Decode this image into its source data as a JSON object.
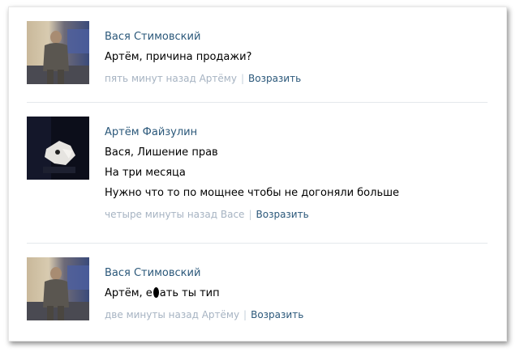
{
  "comments": [
    {
      "author": "Вася Стимовский",
      "lines": [
        "Артём, причина продажи?"
      ],
      "time": "пять минут назад Артёму",
      "reply_label": "Возразить",
      "avatar_icon": "man-photo-avatar"
    },
    {
      "author": "Артём Файзулин",
      "lines": [
        "Вася, Лишение прав",
        "На три месяца",
        "Нужно что то по мощнее чтобы не догоняли больше"
      ],
      "time": "четыре минуты назад Васе",
      "reply_label": "Возразить",
      "avatar_icon": "dark-photo-avatar"
    },
    {
      "author": "Вася Стимовский",
      "text_prefix": "Артём, е",
      "text_suffix": "ать ты тип",
      "time": "две минуты назад Артёму",
      "reply_label": "Возразить",
      "avatar_icon": "man-photo-avatar"
    }
  ],
  "colors": {
    "author": "#2b587a",
    "meta": "#a6b3c2",
    "text": "#000000",
    "divider": "#e4e8ec"
  }
}
